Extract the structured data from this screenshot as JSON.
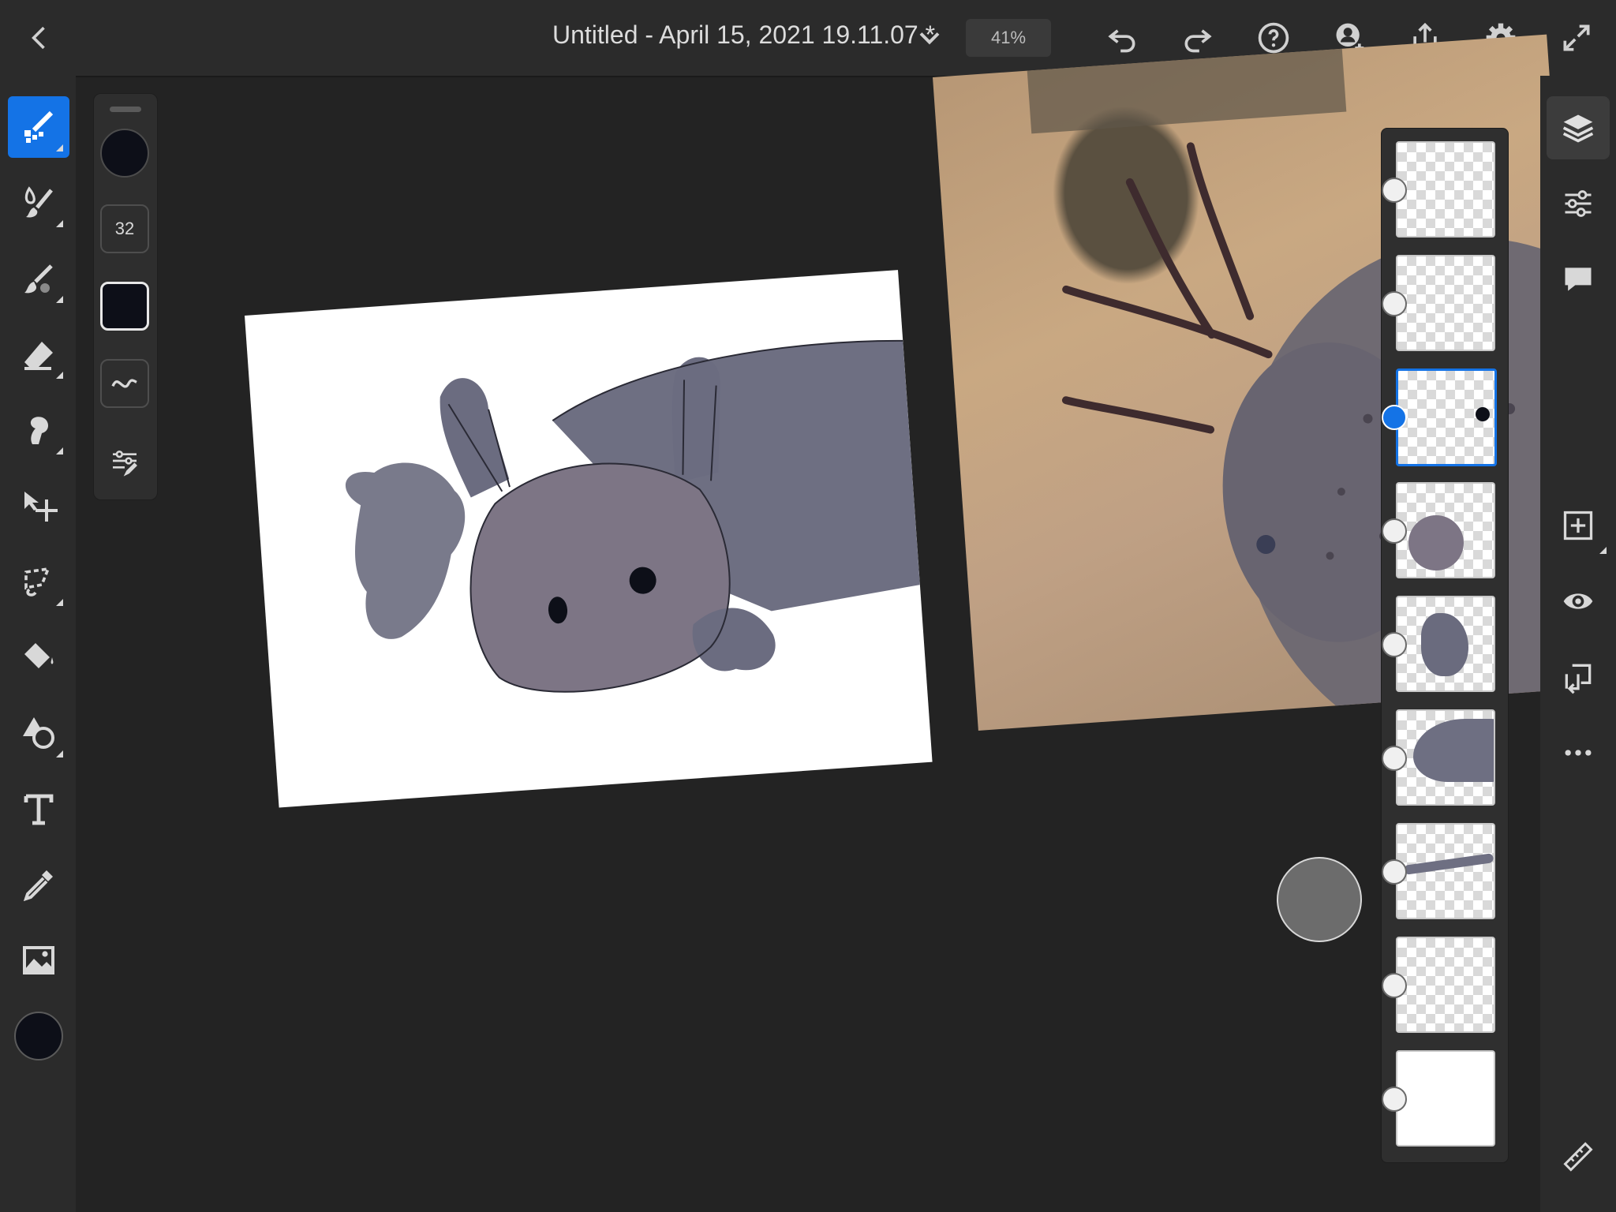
{
  "header": {
    "title": "Untitled - April 15, 2021 19.11.07 *",
    "zoom": "41%",
    "icons": [
      "back-icon",
      "chevron-down-icon",
      "undo-icon",
      "redo-icon",
      "help-icon",
      "invite-icon",
      "share-icon",
      "settings-icon",
      "fullscreen-icon"
    ]
  },
  "tools": [
    "pixel-brush-icon",
    "live-brush-icon",
    "vector-brush-icon",
    "eraser-icon",
    "smudge-icon",
    "move-icon",
    "lasso-icon",
    "fill-icon",
    "shape-icon",
    "type-icon",
    "eyedropper-icon",
    "image-icon",
    "color-swatch"
  ],
  "brush": {
    "size": "32",
    "color": "#0d0f18"
  },
  "layers_panel": {
    "count": 9,
    "active_index": 2
  },
  "right_tools": [
    "layers-icon",
    "adjustments-icon",
    "comments-icon",
    "add-layer-icon",
    "visibility-icon",
    "merge-icon",
    "more-icon",
    "ruler-icon"
  ],
  "colors": {
    "accent": "#1473e6",
    "bg": "#232323",
    "panel": "#2b2b2b"
  }
}
